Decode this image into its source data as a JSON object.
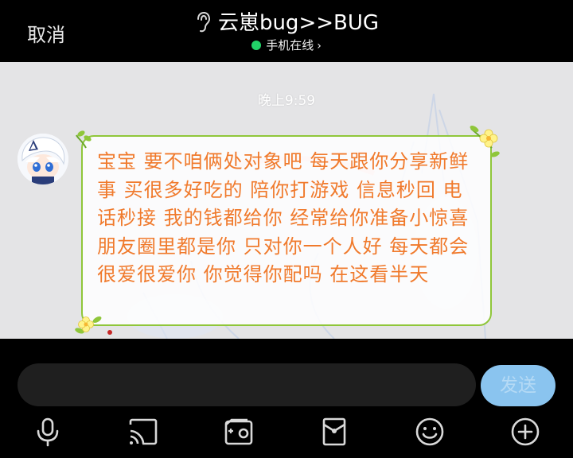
{
  "header": {
    "cancel_label": "取消",
    "contact_name": "云崽bug>>BUG",
    "status_text": "手机在线",
    "status_color": "#22d468",
    "icons": {
      "ear": "ear-icon",
      "online": "online-dot-icon",
      "chevron": "chevron-right-icon"
    }
  },
  "chat": {
    "timestamp": "晚上9:59",
    "message": {
      "text": "宝宝 要不咱俩处对象吧 每天跟你分享新鲜事 买很多好吃的 陪你打游戏 信息秒回 电话秒接 我的钱都给你 经常给你准备小惊喜 朋友圈里都是你 只对你一个人好 每天都会很爱很爱你 你觉得你配吗 在这看半天",
      "text_color": "#f07a2c",
      "bubble_border_color": "#8fc63a"
    }
  },
  "input": {
    "value": "",
    "placeholder": ""
  },
  "send_label": "发送",
  "send_color": "#8ac4ef",
  "toolbar": {
    "icons": [
      "microphone-icon",
      "cast-icon",
      "photo-icon",
      "red-packet-icon",
      "emoji-icon",
      "plus-icon"
    ]
  }
}
